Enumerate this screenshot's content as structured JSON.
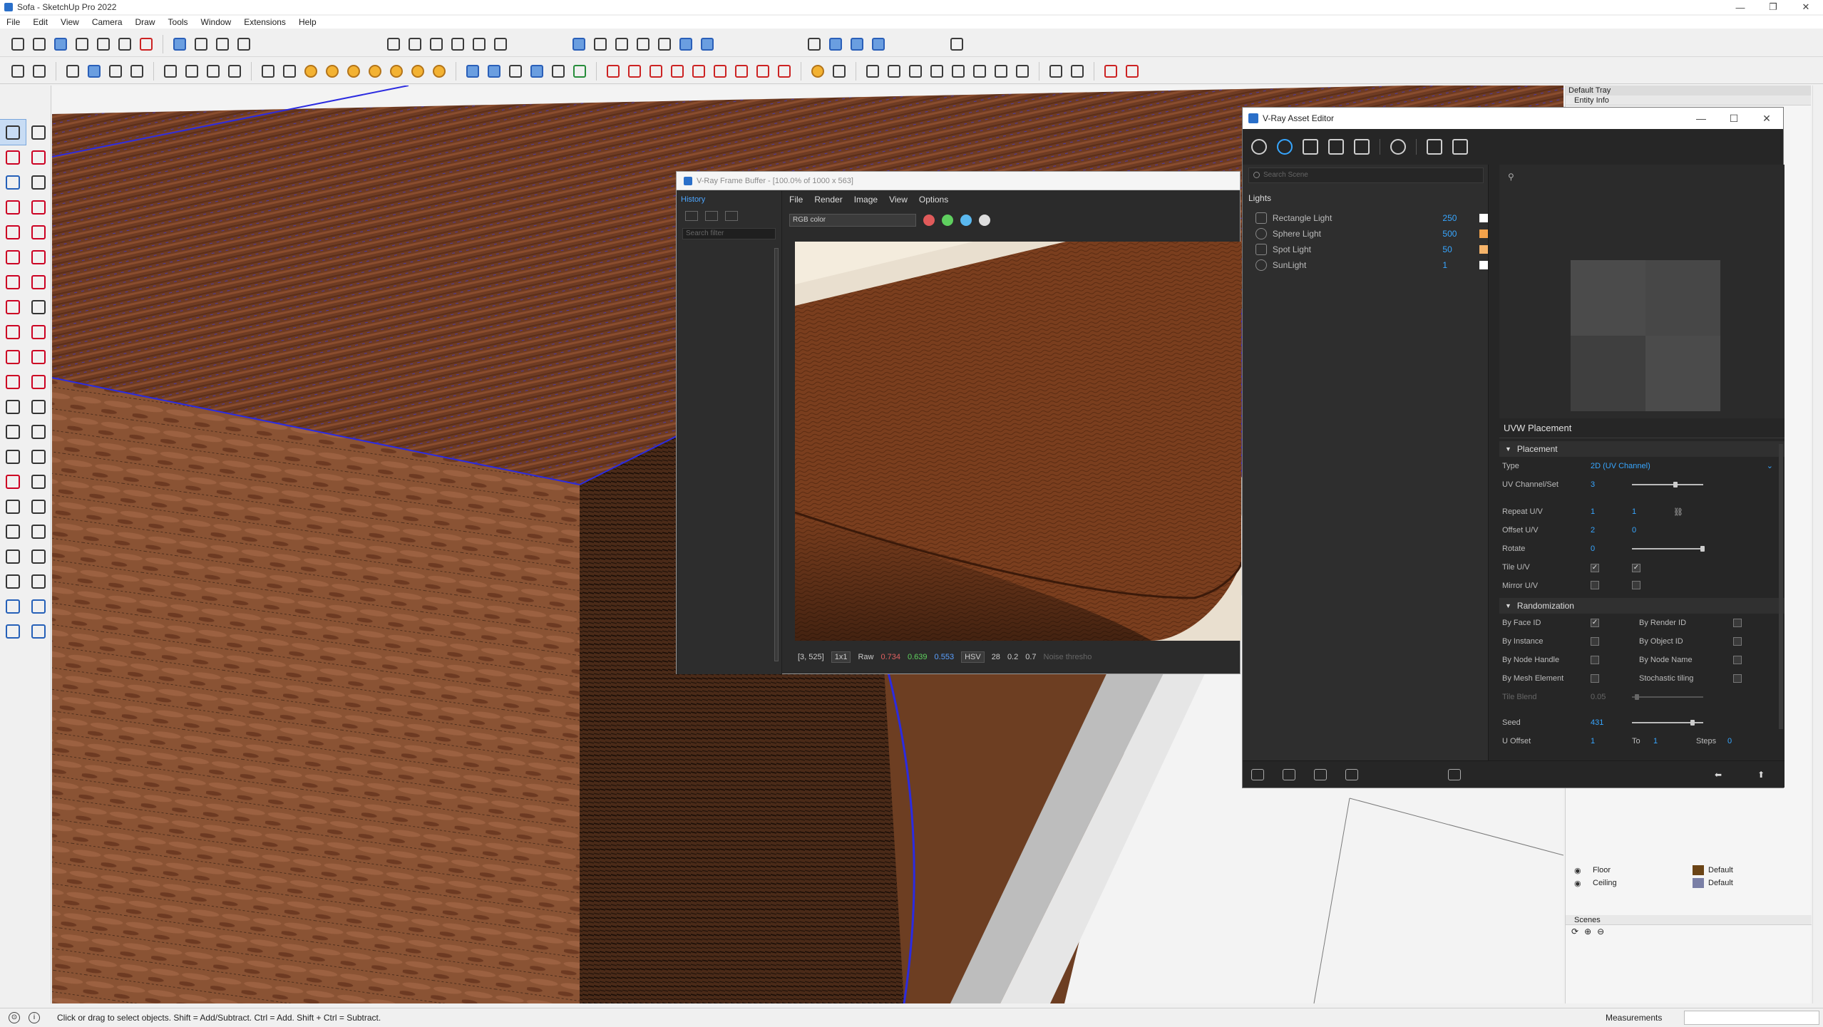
{
  "window": {
    "title": "Sofa - SketchUp Pro 2022",
    "controls": [
      "—",
      "❐",
      "✕"
    ]
  },
  "menu": [
    "File",
    "Edit",
    "View",
    "Camera",
    "Draw",
    "Tools",
    "Window",
    "Extensions",
    "Help"
  ],
  "statusbar": {
    "hint": "Click or drag to select objects. Shift = Add/Subtract. Ctrl = Add. Shift + Ctrl = Subtract.",
    "measurements_label": "Measurements"
  },
  "tray": {
    "title": "Default Tray",
    "section": "Entity Info",
    "tags": [
      {
        "name": "Floor",
        "material": "Default",
        "color": "#6b4416"
      },
      {
        "name": "Ceiling",
        "material": "Default",
        "color": "#7a7fa6"
      }
    ],
    "scenes_title": "Scenes"
  },
  "frame_buffer": {
    "title": "V-Ray Frame Buffer - [100.0% of 1000 x 563]",
    "history_title": "History",
    "history_filter_placeholder": "Search filter",
    "menu": [
      "File",
      "Render",
      "Image",
      "View",
      "Options"
    ],
    "channel": "RGB color",
    "dots": [
      "#e05a5a",
      "#5fcf5f",
      "#5ab8ef"
    ],
    "coords": "[3, 525]",
    "scale": "1x1",
    "raw_label": "Raw",
    "r": "0.734",
    "g": "0.639",
    "b": "0.553",
    "mode": "HSV",
    "h": "28",
    "s": "0.2",
    "v": "0.7",
    "noise": "Noise thresho"
  },
  "asset_editor": {
    "title": "V-Ray Asset Editor",
    "search_placeholder": "Search Scene",
    "category": "Lights",
    "lights": [
      {
        "name": "Rectangle Light",
        "value": "250",
        "color": "#ffffff"
      },
      {
        "name": "Sphere Light",
        "value": "500",
        "color": "#f3a24a"
      },
      {
        "name": "Spot Light",
        "value": "50",
        "color": "#f6b46a"
      },
      {
        "name": "SunLight",
        "value": "1",
        "color": "#ffffff"
      }
    ],
    "panel_title": "UVW Placement",
    "placement": {
      "section": "Placement",
      "type_label": "Type",
      "type_value": "2D (UV Channel)",
      "uv_channel_label": "UV Channel/Set",
      "uv_channel_value": "3",
      "repeat_label": "Repeat U/V",
      "repeat_u": "1",
      "repeat_v": "1",
      "offset_label": "Offset U/V",
      "offset_u": "2",
      "offset_v": "0",
      "rotate_label": "Rotate",
      "rotate_value": "0",
      "tile_label": "Tile U/V",
      "mirror_label": "Mirror U/V"
    },
    "randomization": {
      "section": "Randomization",
      "by_face_id": "By Face ID",
      "by_render_id": "By Render ID",
      "by_instance": "By Instance",
      "by_object_id": "By Object ID",
      "by_node_handle": "By Node Handle",
      "by_node_name": "By Node Name",
      "by_mesh_element": "By Mesh Element",
      "stochastic_tiling": "Stochastic tiling",
      "tile_blend_label": "Tile Blend",
      "tile_blend_value": "0.05",
      "seed_label": "Seed",
      "seed_value": "431",
      "u_offset_label": "U Offset",
      "u_offset_value": "1",
      "to_label": "To",
      "to_value": "1",
      "steps_label": "Steps",
      "steps_value": "0"
    }
  }
}
